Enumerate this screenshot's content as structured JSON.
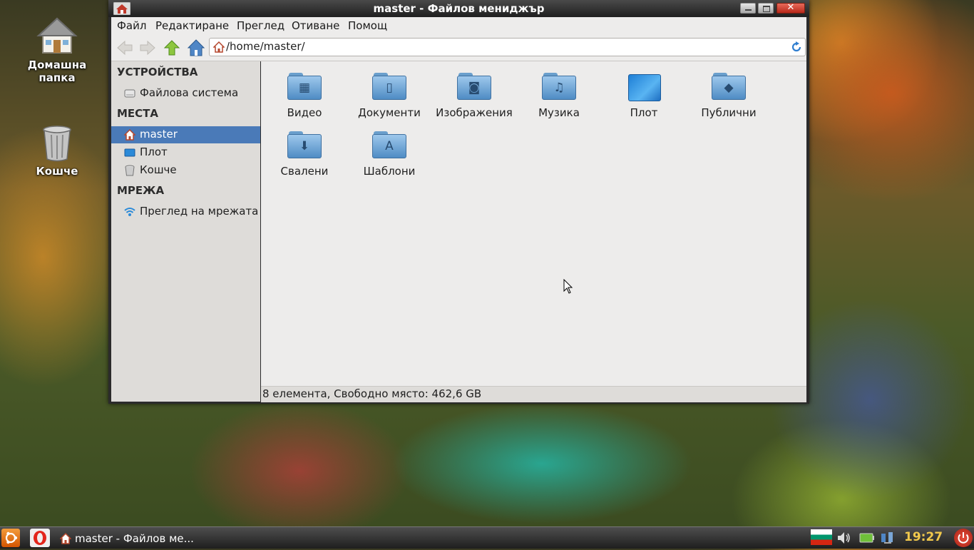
{
  "desktop": {
    "icons": [
      {
        "label_line1": "Домашна",
        "label_line2": "папка",
        "icon": "home-folder-icon"
      },
      {
        "label_line1": "Кошче",
        "label_line2": "",
        "icon": "trash-icon"
      }
    ]
  },
  "window": {
    "title": "master - Файлов мениджър",
    "menu": [
      "Файл",
      "Редактиране",
      "Преглед",
      "Отиване",
      "Помощ"
    ],
    "location": "/home/master/",
    "sidebar": {
      "devices_header": "УСТРОЙСТВА",
      "devices": [
        {
          "label": "Файлова система",
          "icon": "drive-icon"
        }
      ],
      "places_header": "МЕСТА",
      "places": [
        {
          "label": "master",
          "icon": "home-icon",
          "selected": true
        },
        {
          "label": "Плот",
          "icon": "desktop-icon",
          "selected": false
        },
        {
          "label": "Кошче",
          "icon": "trash-icon",
          "selected": false
        }
      ],
      "network_header": "МРЕЖА",
      "network": [
        {
          "label": "Преглед на мрежата",
          "icon": "network-icon"
        }
      ]
    },
    "files": [
      {
        "label": "Видео",
        "icon": "video-folder-icon"
      },
      {
        "label": "Документи",
        "icon": "documents-folder-icon"
      },
      {
        "label": "Изображения",
        "icon": "pictures-folder-icon"
      },
      {
        "label": "Музика",
        "icon": "music-folder-icon"
      },
      {
        "label": "Плот",
        "icon": "desktop-folder-icon"
      },
      {
        "label": "Публични",
        "icon": "public-folder-icon"
      },
      {
        "label": "Свалени",
        "icon": "downloads-folder-icon"
      },
      {
        "label": "Шаблони",
        "icon": "templates-folder-icon"
      }
    ],
    "status": "8 елемента, Свободно място: 462,6 GB"
  },
  "panel": {
    "task_label": "master - Файлов ме...",
    "clock": "19:27"
  },
  "colors": {
    "selection": "#4a7ab8",
    "clock": "#f2c94c"
  }
}
